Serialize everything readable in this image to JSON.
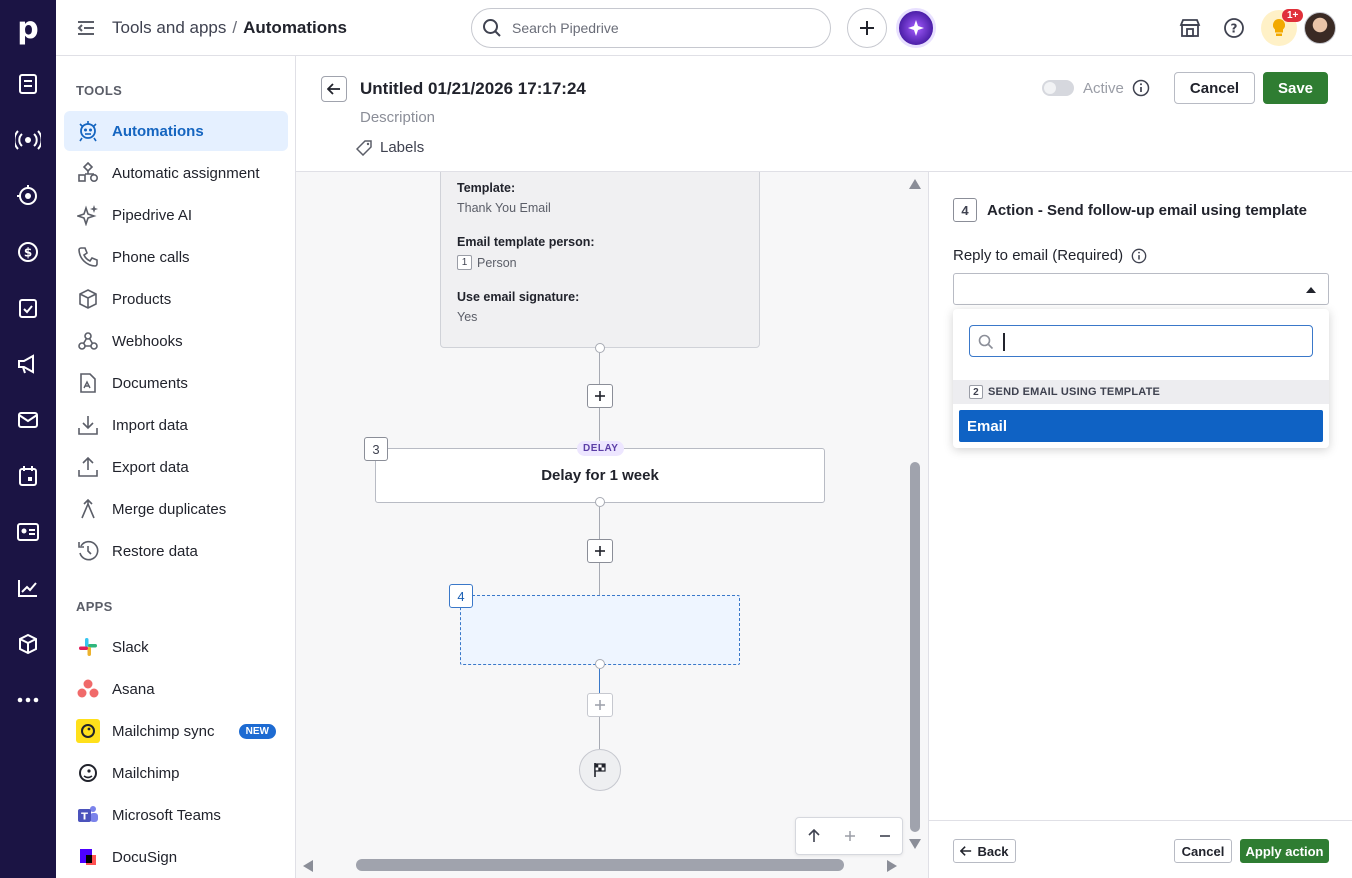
{
  "app": {
    "logo_letter": "p"
  },
  "topbar": {
    "breadcrumb_parent": "Tools and apps",
    "breadcrumb_sep": "/",
    "breadcrumb_current": "Automations",
    "search_placeholder": "Search Pipedrive",
    "notification_count": "1+"
  },
  "rail": {
    "items": [
      "deals-icon",
      "leads-icon",
      "target-icon",
      "dollar-icon",
      "activities-icon",
      "campaigns-icon",
      "mail-icon",
      "calendar-icon",
      "contacts-icon",
      "insights-icon",
      "products-icon",
      "more-icon"
    ]
  },
  "sidebar": {
    "tools_title": "TOOLS",
    "tools": [
      {
        "label": "Automations",
        "icon": "robot-icon",
        "active": true
      },
      {
        "label": "Automatic assignment",
        "icon": "assignment-icon"
      },
      {
        "label": "Pipedrive AI",
        "icon": "sparkle-icon"
      },
      {
        "label": "Phone calls",
        "icon": "phone-icon"
      },
      {
        "label": "Products",
        "icon": "box-icon"
      },
      {
        "label": "Webhooks",
        "icon": "webhook-icon"
      },
      {
        "label": "Documents",
        "icon": "document-icon"
      },
      {
        "label": "Import data",
        "icon": "import-icon"
      },
      {
        "label": "Export data",
        "icon": "export-icon"
      },
      {
        "label": "Merge duplicates",
        "icon": "merge-icon"
      },
      {
        "label": "Restore data",
        "icon": "restore-icon"
      }
    ],
    "apps_title": "APPS",
    "apps": [
      {
        "label": "Slack",
        "icon": "slack-icon"
      },
      {
        "label": "Asana",
        "icon": "asana-icon"
      },
      {
        "label": "Mailchimp sync",
        "icon": "mailchimp-sync-icon",
        "badge": "NEW"
      },
      {
        "label": "Mailchimp",
        "icon": "mailchimp-icon"
      },
      {
        "label": "Microsoft Teams",
        "icon": "teams-icon"
      },
      {
        "label": "DocuSign",
        "icon": "docusign-icon"
      }
    ]
  },
  "editor": {
    "title": "Untitled 01/21/2026 17:17:24",
    "description_placeholder": "Description",
    "labels": "Labels",
    "active_label": "Active",
    "cancel": "Cancel",
    "save": "Save"
  },
  "canvas": {
    "email_card": {
      "template_key": "Template:",
      "template_val": "Thank You Email",
      "person_key": "Email template person:",
      "person_num": "1",
      "person_val": "Person",
      "sig_key": "Use email signature:",
      "sig_val": "Yes"
    },
    "delay_step": {
      "num": "3",
      "tag": "DELAY",
      "label": "Delay for 1 week"
    },
    "new_step": {
      "num": "4"
    }
  },
  "panel": {
    "step_num": "4",
    "title": "Action - Send follow-up email using template",
    "field_label": "Reply to email (Required)",
    "dropdown": {
      "group_num": "2",
      "group_label": "SEND EMAIL USING TEMPLATE",
      "options": [
        "Email"
      ]
    },
    "back": "Back",
    "cancel": "Cancel",
    "apply": "Apply action"
  },
  "colors": {
    "rail": "#1b1444",
    "accent_blue": "#0f62c4",
    "save_green": "#2f7d32",
    "active_bg": "#e5f0ff"
  }
}
